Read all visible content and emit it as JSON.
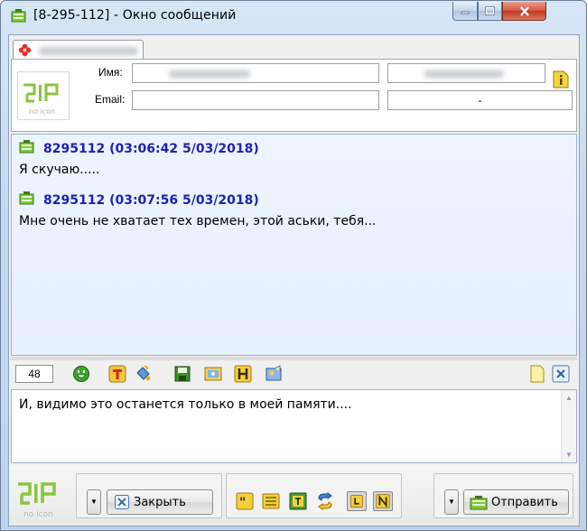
{
  "window": {
    "title": "[8-295-112] - Окно сообщений",
    "controls": [
      "minimize-icon",
      "maximize-icon",
      "close-icon"
    ],
    "close_color": "#c83b22"
  },
  "tab": {
    "label": ""
  },
  "contact": {
    "name_label": "Имя:",
    "email_label": "Email:",
    "name_value": "",
    "phone_value": "",
    "email_value": "",
    "email_extra": "-",
    "logo_text": "no icon"
  },
  "history": {
    "messages": [
      {
        "header": "8295112 (03:06:42 5/03/2018)",
        "text": "Я скучаю....."
      },
      {
        "header": "8295112 (03:07:56 5/03/2018)",
        "text": "Мне очень не хватает тех времен, этой аськи, тебя..."
      }
    ],
    "header_color": "#1f1fb4"
  },
  "toolbar": {
    "font_size": "48",
    "icons": [
      "smiley-icon",
      "text-color-icon",
      "paint-bucket-icon",
      "save-icon",
      "send-picture-icon",
      "history-icon",
      "contact-card-icon"
    ],
    "right_icons": [
      "new-note-icon",
      "clear-icon"
    ]
  },
  "input": {
    "value": "И, видимо это останется только в моей памяти...."
  },
  "bottom": {
    "logo_text": "no icon",
    "close_label": "Закрыть",
    "send_label": "Отправить",
    "mini_icons": [
      "quote-icon",
      "template-icon",
      "translit-icon",
      "exchange-icon",
      "hold-icon",
      "notify-icon"
    ]
  }
}
